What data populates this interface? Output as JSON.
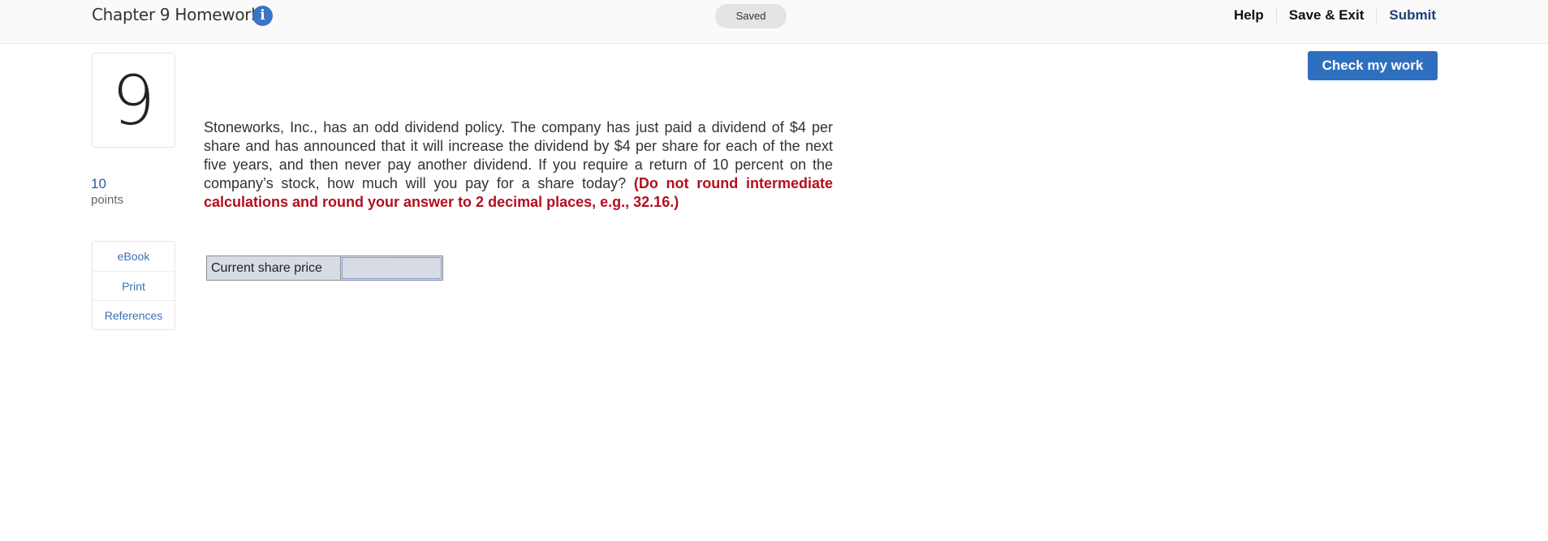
{
  "header": {
    "title": "Chapter 9 Homework",
    "info_icon": "i",
    "save_status": "Saved",
    "nav": {
      "help": "Help",
      "save_exit": "Save & Exit",
      "submit": "Submit"
    }
  },
  "question": {
    "number": "9",
    "points_value": "10",
    "points_label": "points",
    "tools": [
      "eBook",
      "Print",
      "References"
    ],
    "check_button": "Check my work",
    "text": "Stoneworks, Inc., has an odd dividend policy. The company has just paid a dividend of $4 per share and has announced that it will increase the dividend by $4 per share for each of the next five years, and then never pay another dividend. If you require a return of 10 percent on the company’s stock, how much will you pay for a share today? ",
    "instruction": "(Do not round intermediate calculations and round your answer to 2 decimal places, e.g., 32.16.)",
    "answer_label": "Current share price",
    "answer_value": ""
  },
  "colors": {
    "accent": "#2f6fc0",
    "link": "#3b6fb6",
    "instruction": "#b2101e",
    "submit": "#1c3f7a"
  }
}
